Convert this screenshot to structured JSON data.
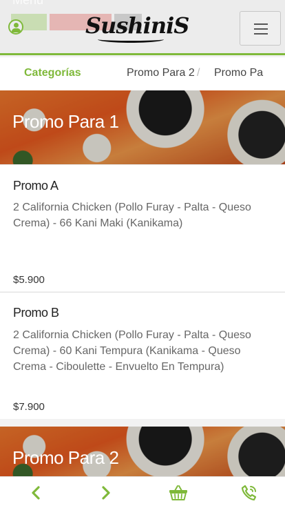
{
  "header": {
    "bg_text": "Menú",
    "logo_text": "SushiniS",
    "user_icon": "user-circle-icon",
    "menu_icon": "hamburger-icon"
  },
  "tabs": [
    {
      "label": "Categorías",
      "active": true
    },
    {
      "label": "Promo Para 2",
      "active": false
    },
    {
      "label": "Promo Pa",
      "active": false
    }
  ],
  "sections": [
    {
      "title": "Promo Para 1",
      "items": [
        {
          "name": "Promo A",
          "description": "2 California Chicken (Pollo Furay - Palta - Queso Crema) - 66 Kani Maki (Kanikama)",
          "price": "$5.900"
        },
        {
          "name": "Promo B",
          "description": "2 California Chicken (Pollo Furay - Palta - Queso Crema) - 60 Kani Tempura (Kanikama - Queso Crema - Ciboulette - Envuelto En Tempura)",
          "price": "$7.900"
        }
      ]
    },
    {
      "title": "Promo Para 2",
      "items": []
    }
  ],
  "bottom_nav": {
    "back_icon": "chevron-left-icon",
    "forward_icon": "chevron-right-icon",
    "cart_icon": "basket-icon",
    "call_icon": "phone-icon"
  },
  "colors": {
    "accent": "#7fb93a",
    "header_bg": "#ececec",
    "text": "#333333",
    "muted": "#666666"
  }
}
